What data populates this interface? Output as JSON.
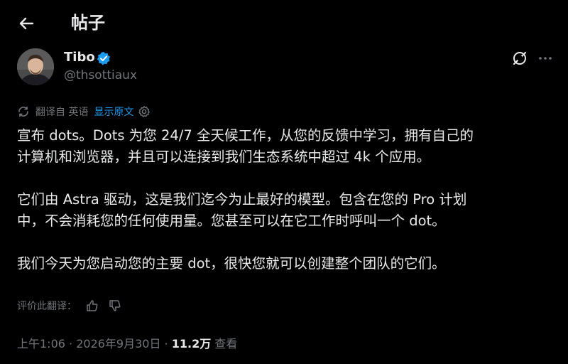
{
  "header": {
    "title": "帖子"
  },
  "post": {
    "author": {
      "name": "Tibo",
      "handle": "@thsottiaux"
    },
    "translation": {
      "label": "翻译自 英语",
      "show_original": "显示原文"
    },
    "paragraphs": [
      "宣布 dots。Dots 为您 24/7 全天候工作，从您的反馈中学习，拥有自己的\n计算机和浏览器，并且可以连接到我们生态系统中超过 4k 个应用。",
      "它们由 Astra 驱动，这是我们迄今为止最好的模型。包含在您的 Pro 计划\n中，不会消耗您的任何使用量。您甚至可以在它工作时呼叫一个 dot。",
      "我们今天为您启动您的主要 dot，很快您就可以创建整个团队的它们。"
    ],
    "rate_translation": "评价此翻译：",
    "meta": {
      "time": "上午1:06",
      "sep1": " · ",
      "date": "2026年9月30日",
      "sep2": " · ",
      "views": "11.2万",
      "views_label": " 查看"
    }
  },
  "colors": {
    "background": "#000000",
    "text": "#e7e9ea",
    "muted": "#71767b",
    "accent": "#1d9bf0"
  },
  "icons": [
    "back-arrow-icon",
    "verified-badge-icon",
    "grok-icon",
    "more-icon",
    "translate-icon",
    "gear-icon",
    "thumbs-up-icon",
    "thumbs-down-icon"
  ]
}
